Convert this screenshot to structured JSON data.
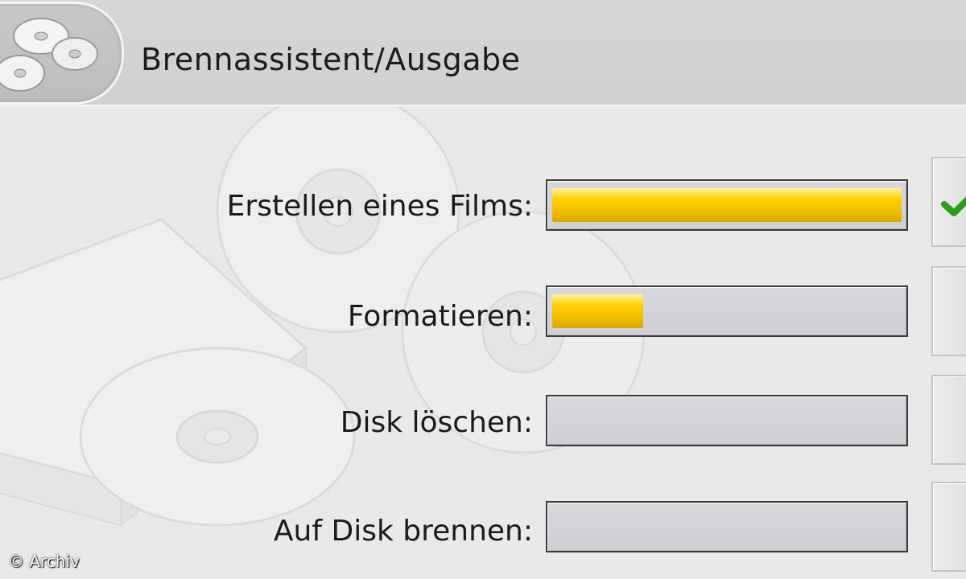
{
  "window": {
    "title": "Brennassistent/Ausgabe",
    "logo_icon": "disc-stack-icon"
  },
  "tasks": [
    {
      "label": "Erstellen eines Films:",
      "progress": 1.0,
      "status": "done",
      "status_icon": "checkmark-icon"
    },
    {
      "label": "Formatieren:",
      "progress": 0.26,
      "status": "in-progress",
      "status_icon": ""
    },
    {
      "label": "Disk löschen:",
      "progress": 0.0,
      "status": "pending",
      "status_icon": ""
    },
    {
      "label": "Auf Disk brennen:",
      "progress": 0.0,
      "status": "pending",
      "status_icon": ""
    }
  ],
  "colors": {
    "progress_fill": "#f2c600",
    "check": "#2e9a1e",
    "header_bg": "#d3d3d3",
    "panel_bg": "#e9e9e9"
  },
  "copyright": "© Archiv"
}
